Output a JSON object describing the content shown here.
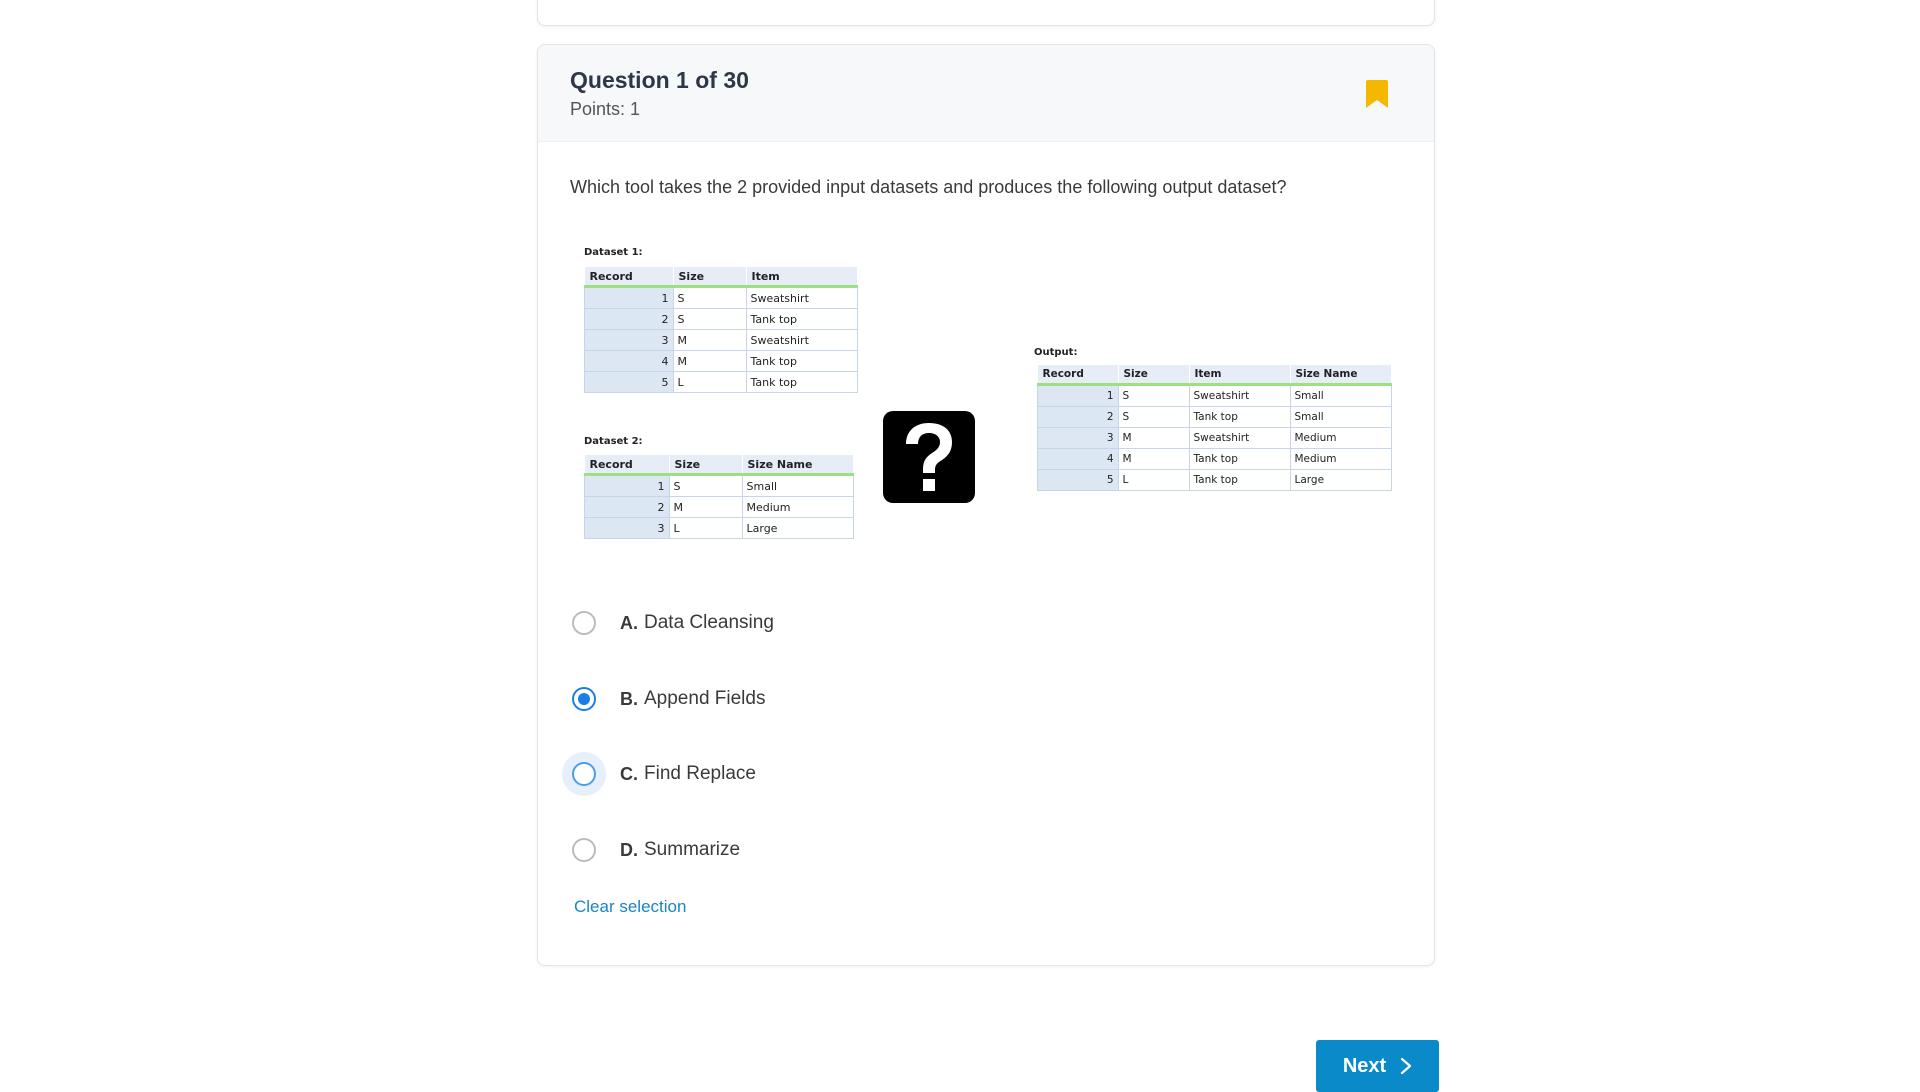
{
  "question": {
    "title": "Question 1 of 30",
    "points": "Points: 1",
    "text": "Which tool takes the 2 provided input datasets and produces the following output dataset?",
    "bookmark_icon": "bookmark-icon",
    "bookmark_color": "#f5b800"
  },
  "figure": {
    "dataset1": {
      "label": "Dataset 1:",
      "headers": [
        "Record",
        "Size",
        "Item"
      ],
      "rows": [
        [
          "1",
          "S",
          "Sweatshirt"
        ],
        [
          "2",
          "S",
          "Tank top"
        ],
        [
          "3",
          "M",
          "Sweatshirt"
        ],
        [
          "4",
          "M",
          "Tank top"
        ],
        [
          "5",
          "L",
          "Tank top"
        ]
      ]
    },
    "dataset2": {
      "label": "Dataset 2:",
      "headers": [
        "Record",
        "Size",
        "Size Name"
      ],
      "rows": [
        [
          "1",
          "S",
          "Small"
        ],
        [
          "2",
          "M",
          "Medium"
        ],
        [
          "3",
          "L",
          "Large"
        ]
      ]
    },
    "question_mark": "?",
    "output": {
      "label": "Output:",
      "headers": [
        "Record",
        "Size",
        "Item",
        "Size Name"
      ],
      "rows": [
        [
          "1",
          "S",
          "Sweatshirt",
          "Small"
        ],
        [
          "2",
          "S",
          "Tank top",
          "Small"
        ],
        [
          "3",
          "M",
          "Sweatshirt",
          "Medium"
        ],
        [
          "4",
          "M",
          "Tank top",
          "Medium"
        ],
        [
          "5",
          "L",
          "Tank top",
          "Large"
        ]
      ]
    }
  },
  "options": [
    {
      "letter": "A.",
      "text": "Data Cleansing",
      "state": "unselected"
    },
    {
      "letter": "B.",
      "text": "Append Fields",
      "state": "selected"
    },
    {
      "letter": "C.",
      "text": "Find Replace",
      "state": "hover"
    },
    {
      "letter": "D.",
      "text": "Summarize",
      "state": "unselected"
    }
  ],
  "clear_label": "Clear selection",
  "next": {
    "label": "Next",
    "icon": "chevron-right-icon"
  },
  "colors": {
    "accent": "#1a7fe6",
    "link": "#1a85c4",
    "next_button": "#0a8ac8"
  }
}
